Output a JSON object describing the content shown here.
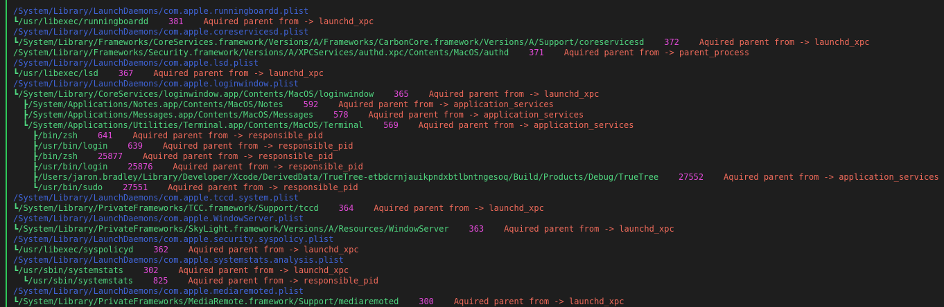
{
  "colors": {
    "background": "#1e1e1e",
    "tree_rail": "#2fc95a",
    "path": "#4fd47e",
    "plist": "#3f63d6",
    "pid": "#e24ad8",
    "message": "#ee6a5a"
  },
  "lines": [
    {
      "kind": "partial",
      "text": ""
    },
    {
      "kind": "plist",
      "text": "/System/Library/LaunchDaemons/com.apple.runningboardd.plist"
    },
    {
      "kind": "proc",
      "depth": 1,
      "branch": "┗",
      "path": "/usr/libexec/runningboardd",
      "pid": "381",
      "message": "Aquired parent from -> launchd_xpc"
    },
    {
      "kind": "plist",
      "text": "/System/Library/LaunchDaemons/com.apple.coreservicesd.plist"
    },
    {
      "kind": "proc",
      "depth": 1,
      "branch": "┗",
      "path": "/System/Library/Frameworks/CoreServices.framework/Versions/A/Frameworks/CarbonCore.framework/Versions/A/Support/coreservicesd",
      "pid": "372",
      "message": "Aquired parent from -> launchd_xpc"
    },
    {
      "kind": "root",
      "path": "/System/Library/Frameworks/Security.framework/Versions/A/XPCServices/authd.xpc/Contents/MacOS/authd",
      "pid": "371",
      "message": "Aquired parent from -> parent_process"
    },
    {
      "kind": "plist",
      "text": "/System/Library/LaunchDaemons/com.apple.lsd.plist"
    },
    {
      "kind": "proc",
      "depth": 1,
      "branch": "┗",
      "path": "/usr/libexec/lsd",
      "pid": "367",
      "message": "Aquired parent from -> launchd_xpc"
    },
    {
      "kind": "plist",
      "text": "/System/Library/LaunchDaemons/com.apple.loginwindow.plist"
    },
    {
      "kind": "proc",
      "depth": 1,
      "branch": "┗",
      "path": "/System/Library/CoreServices/loginwindow.app/Contents/MacOS/loginwindow",
      "pid": "365",
      "message": "Aquired parent from -> launchd_xpc"
    },
    {
      "kind": "proc",
      "depth": 2,
      "branch": "┣",
      "path": "/System/Applications/Notes.app/Contents/MacOS/Notes",
      "pid": "592",
      "message": "Aquired parent from -> application_services"
    },
    {
      "kind": "proc",
      "depth": 2,
      "branch": "┣",
      "path": "/System/Applications/Messages.app/Contents/MacOS/Messages",
      "pid": "578",
      "message": "Aquired parent from -> application_services"
    },
    {
      "kind": "proc",
      "depth": 2,
      "branch": "┗",
      "path": "/System/Applications/Utilities/Terminal.app/Contents/MacOS/Terminal",
      "pid": "569",
      "message": "Aquired parent from -> application_services"
    },
    {
      "kind": "proc",
      "depth": 3,
      "branch": "┣",
      "path": "/bin/zsh",
      "pid": "641",
      "message": "Aquired parent from -> responsible_pid"
    },
    {
      "kind": "proc",
      "depth": 3,
      "branch": "┣",
      "path": "/usr/bin/login",
      "pid": "639",
      "message": "Aquired parent from -> responsible_pid"
    },
    {
      "kind": "proc",
      "depth": 3,
      "branch": "┣",
      "path": "/bin/zsh",
      "pid": "25877",
      "message": "Aquired parent from -> responsible_pid"
    },
    {
      "kind": "proc",
      "depth": 3,
      "branch": "┣",
      "path": "/usr/bin/login",
      "pid": "25876",
      "message": "Aquired parent from -> responsible_pid"
    },
    {
      "kind": "proc",
      "depth": 3,
      "branch": "┣",
      "path": "/Users/jaron.bradley/Library/Developer/Xcode/DerivedData/TrueTree-etbdcrnjauikpndxbtlbntngesoq/Build/Products/Debug/TrueTree",
      "pid": "27552",
      "message": "Aquired parent from -> application_services"
    },
    {
      "kind": "proc",
      "depth": 3,
      "branch": "┗",
      "path": "/usr/bin/sudo",
      "pid": "27551",
      "message": "Aquired parent from -> responsible_pid"
    },
    {
      "kind": "plist",
      "text": "/System/Library/LaunchDaemons/com.apple.tccd.system.plist"
    },
    {
      "kind": "proc",
      "depth": 1,
      "branch": "┗",
      "path": "/System/Library/PrivateFrameworks/TCC.framework/Support/tccd",
      "pid": "364",
      "message": "Aquired parent from -> launchd_xpc"
    },
    {
      "kind": "plist",
      "text": "/System/Library/LaunchDaemons/com.apple.WindowServer.plist"
    },
    {
      "kind": "proc",
      "depth": 1,
      "branch": "┗",
      "path": "/System/Library/PrivateFrameworks/SkyLight.framework/Versions/A/Resources/WindowServer",
      "pid": "363",
      "message": "Aquired parent from -> launchd_xpc"
    },
    {
      "kind": "plist",
      "text": "/System/Library/LaunchDaemons/com.apple.security.syspolicy.plist"
    },
    {
      "kind": "proc",
      "depth": 1,
      "branch": "┗",
      "path": "/usr/libexec/syspolicyd",
      "pid": "362",
      "message": "Aquired parent from -> launchd_xpc"
    },
    {
      "kind": "plist",
      "text": "/System/Library/LaunchDaemons/com.apple.systemstats.analysis.plist"
    },
    {
      "kind": "proc",
      "depth": 1,
      "branch": "┗",
      "path": "/usr/sbin/systemstats",
      "pid": "302",
      "message": "Aquired parent from -> launchd_xpc"
    },
    {
      "kind": "proc",
      "depth": 2,
      "branch": "┗",
      "path": "/usr/sbin/systemstats",
      "pid": "825",
      "message": "Aquired parent from -> responsible_pid"
    },
    {
      "kind": "plist",
      "text": "/System/Library/LaunchDaemons/com.apple.mediaremoted.plist"
    },
    {
      "kind": "proc",
      "depth": 1,
      "branch": "┗",
      "path": "/System/Library/PrivateFrameworks/MediaRemote.framework/Support/mediaremoted",
      "pid": "300",
      "message": "Aquired parent from -> launchd_xpc"
    }
  ]
}
